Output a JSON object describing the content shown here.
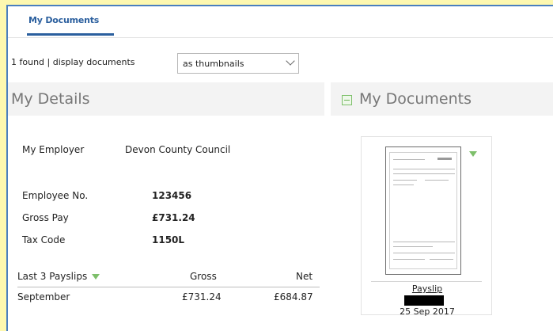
{
  "tabs": [
    {
      "label": "My Documents"
    }
  ],
  "toolbar": {
    "found_text": "1 found  |  display documents",
    "display_select": "as thumbnails"
  },
  "details": {
    "title": "My Details",
    "employer_label": "My Employer",
    "employer_value": "Devon County Council",
    "employee_no_label": "Employee No.",
    "employee_no_value": "123456",
    "gross_pay_label": "Gross Pay",
    "gross_pay_value": "£731.24",
    "tax_code_label": "Tax Code",
    "tax_code_value": "1150L",
    "payslips": {
      "heading": "Last 3 Payslips",
      "col_gross": "Gross",
      "col_net": "Net",
      "rows": [
        {
          "month": "September",
          "gross": "£731.24",
          "net": "£684.87"
        }
      ]
    }
  },
  "documents": {
    "title": "My Documents",
    "items": [
      {
        "title": "Payslip",
        "date": "25 Sep 2017"
      }
    ]
  },
  "colors": {
    "accent": "#2b5f9e",
    "page_bg": "#fdf8b0",
    "green_icon": "#7dbf6a"
  }
}
